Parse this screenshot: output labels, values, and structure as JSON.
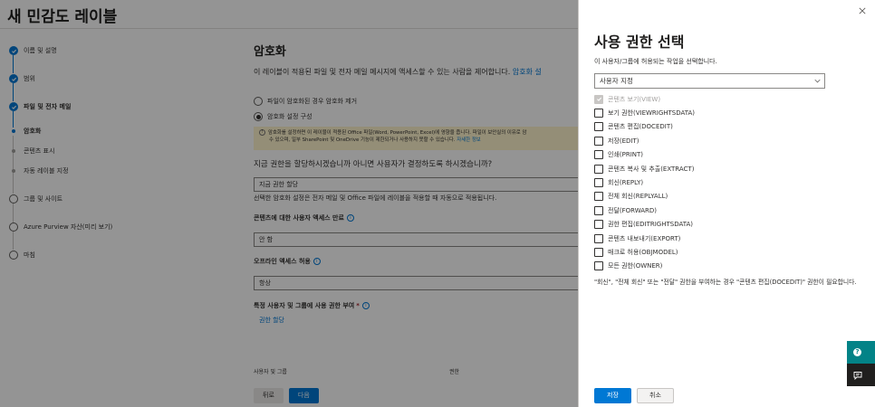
{
  "page": {
    "title": "새 민감도 레이블",
    "steps": [
      {
        "label": "이름 및 설명",
        "state": "done"
      },
      {
        "label": "범위",
        "state": "done"
      },
      {
        "label": "파일 및 전자 메일",
        "state": "current"
      },
      {
        "label": "암호화",
        "state": "sub-current"
      },
      {
        "label": "콘텐츠 표시",
        "state": "sub"
      },
      {
        "label": "자동 레이블 지정",
        "state": "sub"
      },
      {
        "label": "그룹 및 사이트",
        "state": "open"
      },
      {
        "label": "Azure Purview 자산(미리 보기)",
        "state": "open"
      },
      {
        "label": "마침",
        "state": "open"
      }
    ],
    "content": {
      "heading": "암호화",
      "description": "이 레이블이 적용된 파일 및 전자 메일 메시지에 액세스할 수 있는 사람을 제어합니다.",
      "description_link": "암호화 설",
      "radio_remove": "파일이 암호화된 경우 암호화 제거",
      "radio_configure": "암호화 설정 구성",
      "warning_line1": "암호화를 설정하면 이 레이블이 적용된 Office 파일(Word, PowerPoint, Excel)에 영향을 줍니다. 파일이 보안실의 이유로 암",
      "warning_line2": "수 있으며, 일부 SharePoint 및 OneDrive 기능이 제한되거나 사용하지 못할 수 있습니다.",
      "warning_link": "자세한 정보",
      "question": "지금 권한을 할당하시겠습니까 아니면 사용자가 결정하도록 하시겠습니까?",
      "assign_value": "지금 권한 할당",
      "assign_hint": "선택한 암호화 설정은 전자 메일 및 Office 파일에 레이블을 적용할 때 자동으로 적용됩니다.",
      "expire_label": "콘텐츠에 대한 사용자 액세스 만료",
      "expire_value": "안 함",
      "offline_label": "오프라인 액세스 허용",
      "offline_value": "항상",
      "assign_perm_label": "특정 사용자 및 그룹에 사용 권한 부여",
      "assign_perm_required": "*",
      "assign_perm_link": "권한 할당",
      "col_users": "사용자 및 그룹",
      "col_perms": "권한"
    },
    "back_label": "뒤로",
    "next_label": "다음"
  },
  "panel": {
    "title": "사용 권한 선택",
    "subtitle": "이 사용자/그룹에 허용되는 작업을 선택합니다.",
    "select_value": "사용자 지정",
    "permissions": [
      {
        "label": "콘텐츠 보기(VIEW)",
        "checked": true,
        "disabled": true
      },
      {
        "label": "보기 권한(VIEWRIGHTSDATA)",
        "checked": false,
        "disabled": false
      },
      {
        "label": "콘텐츠 편집(DOCEDIT)",
        "checked": false,
        "disabled": false
      },
      {
        "label": "저장(EDIT)",
        "checked": false,
        "disabled": false
      },
      {
        "label": "인쇄(PRINT)",
        "checked": false,
        "disabled": false
      },
      {
        "label": "콘텐츠 복사 및 추출(EXTRACT)",
        "checked": false,
        "disabled": false
      },
      {
        "label": "회신(REPLY)",
        "checked": false,
        "disabled": false
      },
      {
        "label": "전체 회신(REPLYALL)",
        "checked": false,
        "disabled": false
      },
      {
        "label": "전달(FORWARD)",
        "checked": false,
        "disabled": false
      },
      {
        "label": "권한 편집(EDITRIGHTSDATA)",
        "checked": false,
        "disabled": false
      },
      {
        "label": "콘텐츠 내보내기(EXPORT)",
        "checked": false,
        "disabled": false
      },
      {
        "label": "매크로 허용(OBJMODEL)",
        "checked": false,
        "disabled": false
      },
      {
        "label": "모든 권한(OWNER)",
        "checked": false,
        "disabled": false
      }
    ],
    "note": "\"회신\", \"전체 회신\" 또는 \"전달\" 권한을 부여하는 경우 \"콘텐츠 편집(DOCEDIT)\" 권한이 필요합니다.",
    "save_label": "저장",
    "cancel_label": "취소"
  },
  "colors": {
    "accent": "#0078d4",
    "help": "#038387",
    "feedback": "#201f1e",
    "warning_bg": "#fff4ce"
  }
}
